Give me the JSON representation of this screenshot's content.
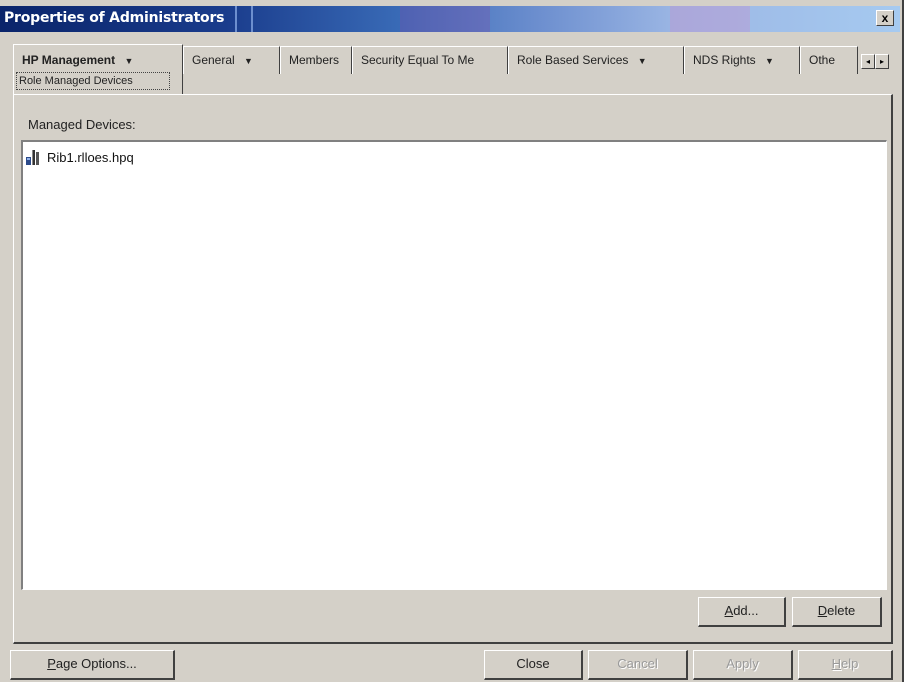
{
  "window": {
    "title": "Properties of Administrators",
    "close_symbol": "x"
  },
  "tabs": {
    "active": {
      "label": "HP Management",
      "sub_label": "Role Managed Devices"
    },
    "items": [
      {
        "label": "General",
        "has_dropdown": true
      },
      {
        "label": "Members",
        "has_dropdown": false
      },
      {
        "label": "Security Equal To Me",
        "has_dropdown": false
      },
      {
        "label": "Role Based Services",
        "has_dropdown": true
      },
      {
        "label": "NDS Rights",
        "has_dropdown": true
      },
      {
        "label": "Othe",
        "has_dropdown": false
      }
    ],
    "scroll_left": "◂",
    "scroll_right": "▸",
    "dropdown_glyph": "▼"
  },
  "panel": {
    "managed_label": "Managed Devices:",
    "devices": [
      {
        "name": "Rib1.rlloes.hpq",
        "icon": "server-icon"
      }
    ],
    "add_button": {
      "prefix": "",
      "mnemonic": "A",
      "rest": "dd..."
    },
    "delete_button": {
      "prefix": "",
      "mnemonic": "D",
      "rest": "elete"
    }
  },
  "footer": {
    "page_options": {
      "mnemonic": "P",
      "rest": "age Options..."
    },
    "close": "Close",
    "cancel": "Cancel",
    "apply": "Apply",
    "help": {
      "mnemonic": "H",
      "rest": "elp"
    }
  },
  "colors": {
    "title_start": "#0a246a",
    "title_end": "#a6caf0",
    "face": "#d4d0c8"
  }
}
